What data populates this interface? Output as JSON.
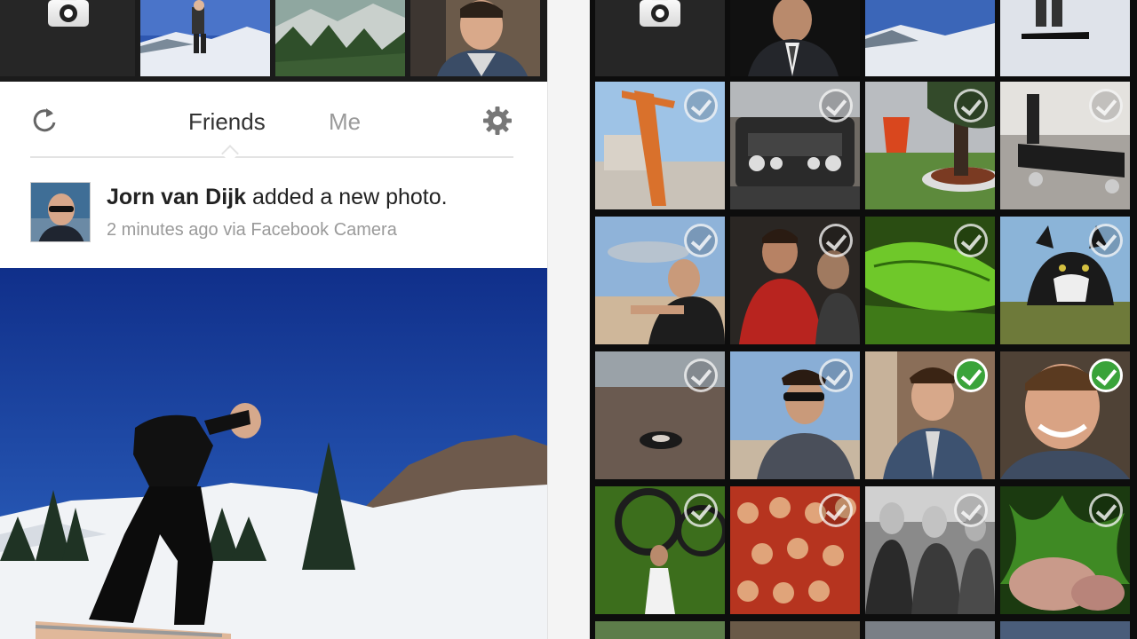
{
  "feed": {
    "tabs": {
      "friends_label": "Friends",
      "me_label": "Me",
      "active": "Friends"
    },
    "post": {
      "author": "Jorn van Dijk",
      "action": "added a new photo.",
      "meta": "2 minutes ago via Facebook Camera"
    }
  },
  "icons": {
    "refresh": "refresh-icon",
    "settings": "gear-icon",
    "camera": "camera-icon",
    "check": "check-circle-icon"
  },
  "colors": {
    "check_selected": "#3aa33a",
    "grid_background": "#0d0d0d",
    "strip_background": "#1b1b1b"
  },
  "photo_grid": {
    "selected_count": 2,
    "tiles": [
      {
        "selected": false
      },
      {
        "selected": false
      },
      {
        "selected": false
      },
      {
        "selected": false
      },
      {
        "selected": false
      },
      {
        "selected": false
      },
      {
        "selected": false
      },
      {
        "selected": false
      },
      {
        "selected": false
      },
      {
        "selected": false
      },
      {
        "selected": true
      },
      {
        "selected": true
      },
      {
        "selected": false
      },
      {
        "selected": false
      },
      {
        "selected": false
      },
      {
        "selected": false
      }
    ]
  }
}
